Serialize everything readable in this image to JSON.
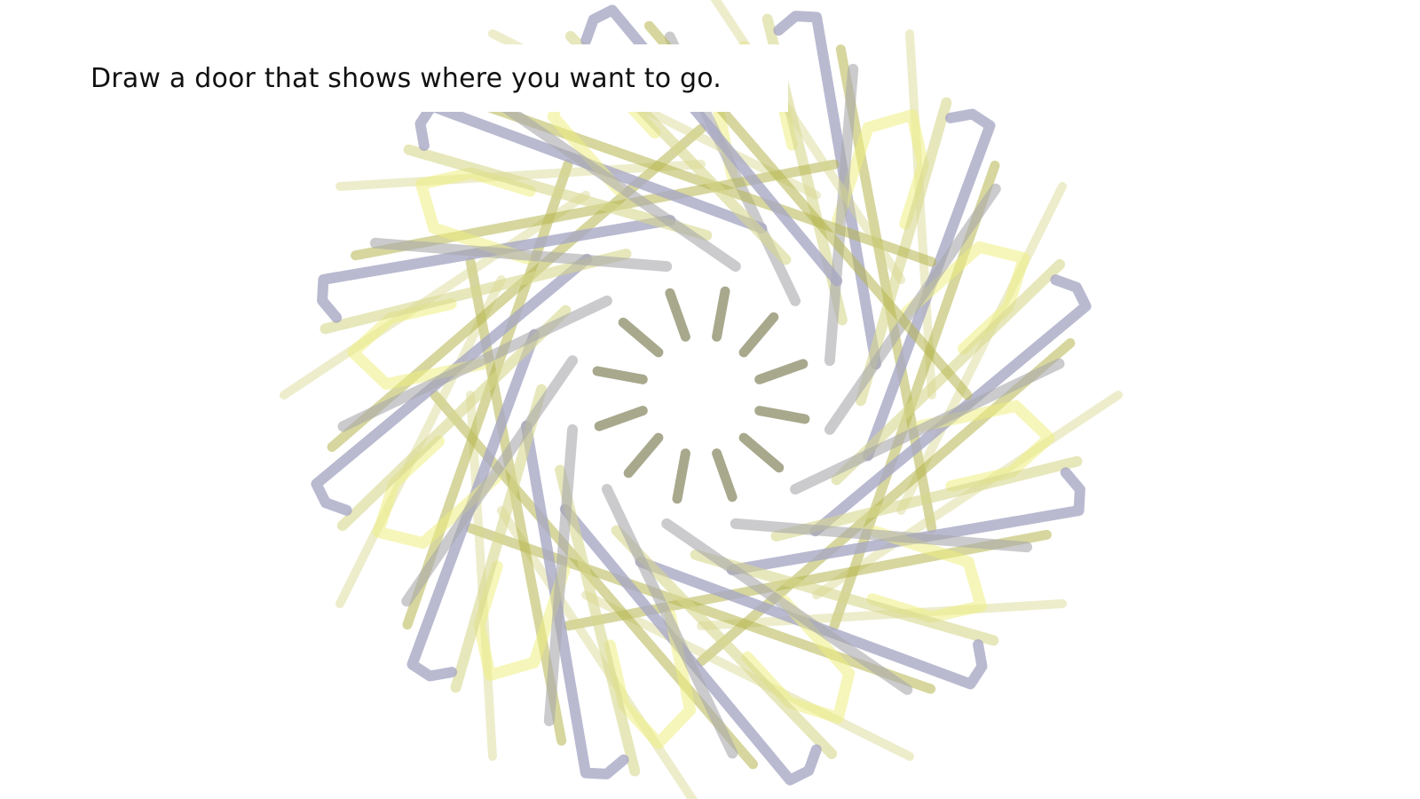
{
  "prompt": {
    "text": "Draw a door that shows where you want to go."
  },
  "drawing": {
    "subject": "radially symmetric scribble of overlapping stroke groups",
    "colors": {
      "pale_yellow": "#eeee82",
      "light_olive": "#d8d890",
      "olive": "#b6b650",
      "dark_olive": "#9a9a7a",
      "gray": "#a9a9ad",
      "lavender": "#a8a8c4"
    }
  }
}
